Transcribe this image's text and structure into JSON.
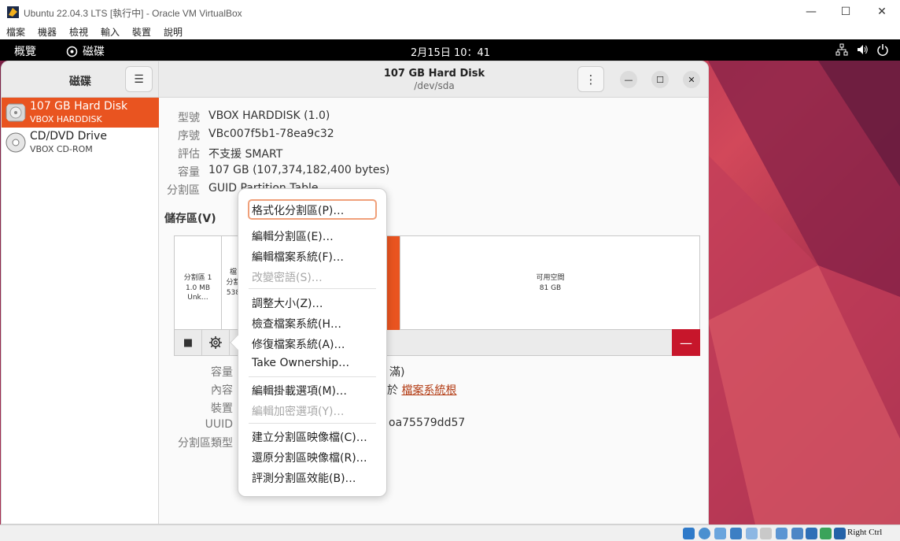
{
  "vbox": {
    "window_title": "Ubuntu 22.04.3 LTS [執行中] - Oracle VM VirtualBox",
    "menu": [
      "檔案",
      "機器",
      "檢視",
      "輸入",
      "裝置",
      "說明"
    ],
    "host_key": "Right Ctrl"
  },
  "gnome": {
    "activities": "概覽",
    "app_name": "磁碟",
    "clock": "2月15日 10：41"
  },
  "disks": {
    "sidebar_title": "磁碟",
    "drives": [
      {
        "name": "107 GB Hard Disk",
        "model": "VBOX HARDDISK",
        "selected": true
      },
      {
        "name": "CD/DVD Drive",
        "model": "VBOX CD-ROM",
        "selected": false
      }
    ],
    "header": {
      "title": "107 GB Hard Disk",
      "subtitle": "/dev/sda"
    },
    "properties": {
      "model_label": "型號",
      "model_value": "VBOX HARDDISK (1.0)",
      "serial_label": "序號",
      "serial_value": "VBc007f5b1-78ea9c32",
      "assessment_label": "評估",
      "assessment_value": "不支援 SMART",
      "size_label": "容量",
      "size_value": "107 GB (107,374,182,400 bytes)",
      "partitioning_label": "分割區",
      "partitioning_value": "GUID Partition Table"
    },
    "volumes_title": "儲存區(V)",
    "segments": [
      {
        "line1": "分割區 1",
        "line2": "1.0 MB Unk…"
      },
      {
        "line1": "檔",
        "line2": "分割",
        "line3": "538"
      },
      {
        "line1": "",
        "line2": ""
      },
      {
        "line1": "可用空間",
        "line2": "81 GB"
      }
    ],
    "volume_details": {
      "size_label": "容量",
      "size_value_tail": "滿)",
      "contents_label": "內容",
      "contents_prefix": "於 ",
      "contents_link": "檔案系統根",
      "device_label": "裝置",
      "uuid_label": "UUID",
      "uuid_value_tail": "oa75579dd57",
      "partition_type_label": "分割區類型"
    }
  },
  "context_menu": {
    "items": [
      {
        "label": "格式化分割區(P)…",
        "enabled": true
      },
      {
        "label": "編輯分割區(E)…",
        "enabled": true
      },
      {
        "label": "編輯檔案系統(F)…",
        "enabled": true
      },
      {
        "label": "改變密語(S)…",
        "enabled": false
      },
      {
        "label": "調整大小(Z)…",
        "enabled": true
      },
      {
        "label": "檢查檔案系統(H…",
        "enabled": true
      },
      {
        "label": "修復檔案系統(A)…",
        "enabled": true
      },
      {
        "label": "Take Ownership…",
        "enabled": true
      },
      {
        "label": "編輯掛載選項(M)…",
        "enabled": true
      },
      {
        "label": "編輯加密選項(Y)…",
        "enabled": false
      },
      {
        "label": "建立分割區映像檔(C)…",
        "enabled": true
      },
      {
        "label": "還原分割區映像檔(R)…",
        "enabled": true
      },
      {
        "label": "評測分割區效能(B)…",
        "enabled": true
      }
    ]
  },
  "colors": {
    "accent": "#e95420",
    "destructive": "#c7162b",
    "partition_fill": "#e95420"
  }
}
